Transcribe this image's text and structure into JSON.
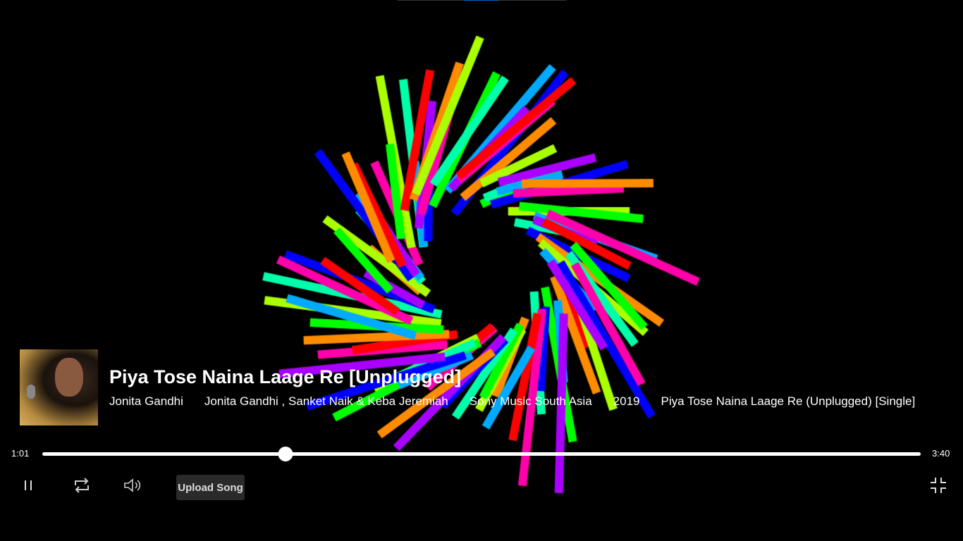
{
  "song": {
    "title": "Piya Tose Naina Laage Re [Unplugged]",
    "artist": "Jonita Gandhi",
    "credits": "Jonita Gandhi , Sanket Naik & Keba Jeremiah",
    "label": "Sony Music South Asia",
    "year": "2019",
    "album": "Piya Tose Naina Laage Re (Unplugged) [Single]"
  },
  "player": {
    "current_time": "1:01",
    "duration": "3:40",
    "progress_percent": 27.7,
    "upload_label": "Upload Song"
  },
  "icons": {
    "play_pause": "pause-icon",
    "repeat": "repeat-icon",
    "volume": "volume-icon",
    "fullscreen": "exit-fullscreen-icon"
  },
  "visualizer_colors": [
    "#ff0000",
    "#ff8c00",
    "#aaff00",
    "#00ff00",
    "#00ffaa",
    "#00aaff",
    "#0000ff",
    "#aa00ff",
    "#ff00aa"
  ]
}
